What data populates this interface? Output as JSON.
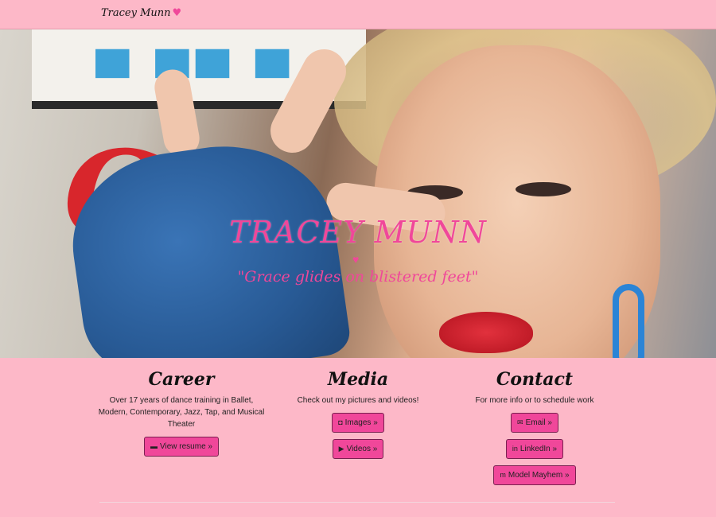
{
  "nav": {
    "brand": "Tracey Munn",
    "brand_heart": "♥"
  },
  "hero": {
    "title": "TRACEY MUNN",
    "heart": "♥",
    "tagline": "\"Grace glides on blistered feet\""
  },
  "columns": [
    {
      "heading": "Career",
      "text": "Over 17 years of dance training in Ballet, Modern, Contemporary, Jazz, Tap, and Musical Theater",
      "buttons": [
        {
          "icon": "folder-open-icon",
          "glyph": "▬",
          "label": "View resume »"
        }
      ]
    },
    {
      "heading": "Media",
      "text": "Check out my pictures and videos!",
      "buttons": [
        {
          "icon": "camera-icon",
          "glyph": "◘",
          "label": "Images »"
        },
        {
          "icon": "youtube-icon",
          "glyph": "▶",
          "label": "Videos »"
        }
      ]
    },
    {
      "heading": "Contact",
      "text": "For more info or to schedule work",
      "buttons": [
        {
          "icon": "envelope-icon",
          "glyph": "✉",
          "label": "Email »"
        },
        {
          "icon": "linkedin-icon",
          "glyph": "in",
          "label": "LinkedIn »"
        },
        {
          "icon": "model-mayhem-icon",
          "glyph": "m",
          "label": "Model Mayhem »"
        }
      ]
    }
  ],
  "colors": {
    "background": "#fdb8c8",
    "accent": "#f0479a"
  }
}
